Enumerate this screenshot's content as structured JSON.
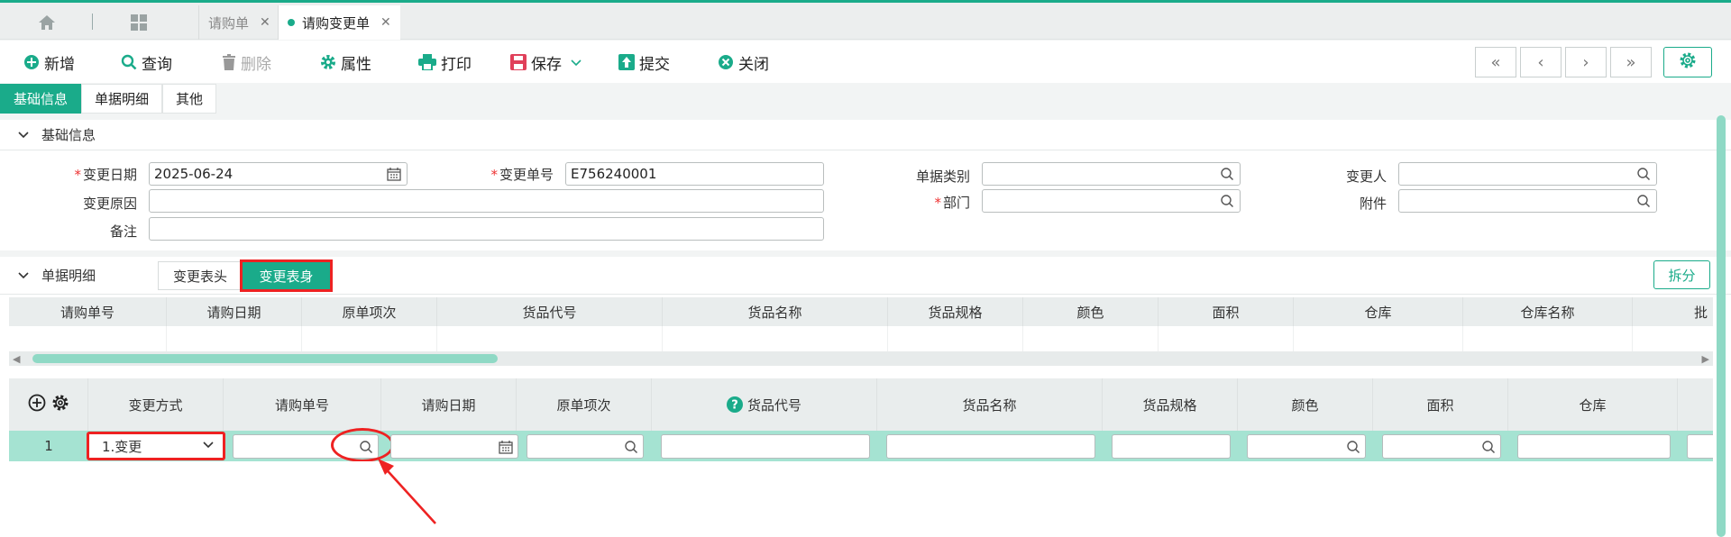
{
  "tabbar": {
    "home_icon": "home-icon",
    "apps_icon": "grid-icon",
    "tabs": [
      {
        "label": "请购单",
        "active": false
      },
      {
        "label": "请购变更单",
        "active": true
      }
    ]
  },
  "toolbar": {
    "add": "新增",
    "query": "查询",
    "delete": "删除",
    "properties": "属性",
    "print": "打印",
    "save": "保存",
    "submit": "提交",
    "close": "关闭",
    "nav": [
      "«",
      "‹",
      "›",
      "»"
    ]
  },
  "page_tabs": [
    "基础信息",
    "单据明细",
    "其他"
  ],
  "basic": {
    "section_title": "基础信息",
    "change_date_label": "变更日期",
    "change_date_value": "2025-06-24",
    "change_no_label": "变更单号",
    "change_no_value": "E756240001",
    "doc_type_label": "单据类别",
    "changer_label": "变更人",
    "reason_label": "变更原因",
    "dept_label": "部门",
    "attach_label": "附件",
    "remark_label": "备注"
  },
  "detail": {
    "section_title": "单据明细",
    "btn_head": "变更表头",
    "btn_body": "变更表身",
    "split": "拆分",
    "grid1_headers": [
      "请购单号",
      "请购日期",
      "原单项次",
      "货品代号",
      "货品名称",
      "货品规格",
      "颜色",
      "面积",
      "仓库",
      "仓库名称",
      "批"
    ],
    "grid2_headers": [
      "变更方式",
      "请购单号",
      "请购日期",
      "原单项次",
      "货品代号",
      "货品名称",
      "货品规格",
      "颜色",
      "面积",
      "仓库"
    ],
    "row_no": "1",
    "change_mode_value": "1.变更",
    "help_icon": "?"
  },
  "colors": {
    "accent": "#1aab8a",
    "highlight_red": "#e22",
    "row_selected": "#a5e3d2"
  }
}
